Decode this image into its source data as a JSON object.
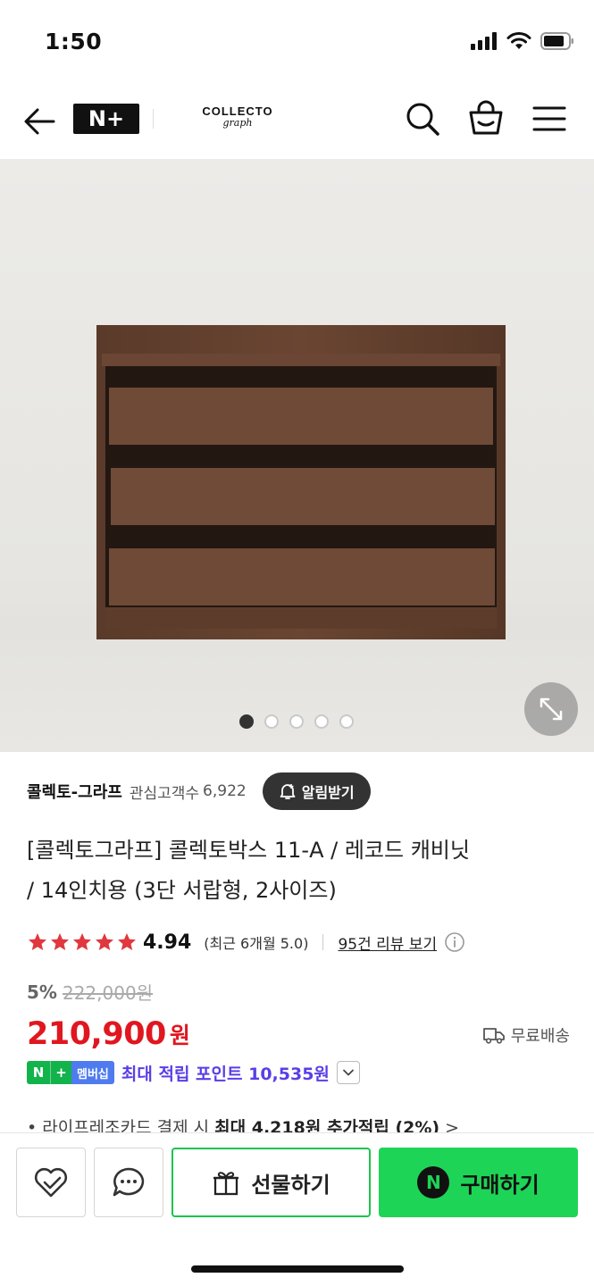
{
  "status_bar": {
    "time": "1:50"
  },
  "nav": {
    "nplus_label": "N+",
    "logo_line1": "COLLECTO",
    "logo_line2": "graph"
  },
  "gallery": {
    "total_images": 5,
    "active_index": 0
  },
  "store": {
    "name": "콜렉토-그라프",
    "fans_label": "관심고객수",
    "fans_count": "6,922",
    "alarm_button": "알림받기"
  },
  "product": {
    "title_line1": "[콜렉토그라프] 콜렉토박스 11-A / 레코드 캐비닛",
    "title_line2": "/ 14인치용 (3단 서랍형, 2사이즈)",
    "rating": "4.94",
    "rating_recent": "(최근 6개월 5.0)",
    "review_link": "95건 리뷰 보기",
    "discount_rate": "5%",
    "original_price": "222,000원",
    "price": "210,900",
    "price_unit": "원",
    "shipping": "무료배송"
  },
  "membership": {
    "badge_n": "N",
    "badge_plus": "+",
    "badge_label": "멤버십",
    "point_text": "최대 적립 포인트 10,535원"
  },
  "card_benefit": {
    "prefix": "• 라이프레조카드 결제 시 ",
    "highlight": "최대 4,218원 추가적립 (2%)",
    "suffix": " >"
  },
  "bottom_bar": {
    "gift_label": "선물하기",
    "buy_label": "구매하기",
    "buy_badge": "N"
  },
  "colors": {
    "price_red": "#e0171f",
    "naver_green": "#1ed456",
    "point_purple": "#5a3ee6",
    "star_red": "#e0383e"
  }
}
